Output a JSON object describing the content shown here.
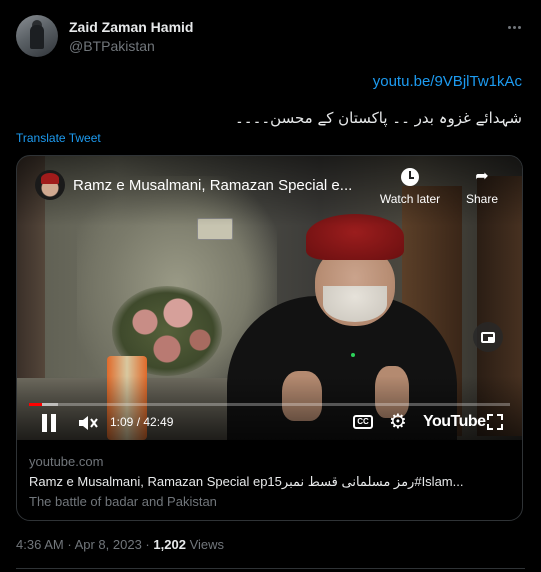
{
  "author": {
    "name": "Zaid Zaman Hamid",
    "handle": "@BTPakistan"
  },
  "tweet": {
    "link": "youtu.be/9VBjlTw1kAc",
    "text": "شہدائے غزوہ بدر ۔۔ پاکستان کے محسن۔۔۔۔",
    "translate_label": "Translate Tweet"
  },
  "video": {
    "title": "Ramz e Musalmani, Ramazan Special e...",
    "watch_later_label": "Watch later",
    "share_label": "Share",
    "time_display": "1:09 / 42:49",
    "progress_fraction": 0.027,
    "buffer_fraction": 0.06,
    "cc_label": "CC",
    "brand_label": "YouTube"
  },
  "card": {
    "domain": "youtube.com",
    "title": "Ramz e Musalmani, Ramazan Special ep15رمز مسلمانی قسط نمبر#Islam...",
    "description": "The battle of badar and Pakistan"
  },
  "footer": {
    "time": "4:36 AM",
    "separator": "·",
    "date": "Apr 8, 2023",
    "views_count": "1,202",
    "views_label": "Views"
  },
  "colors": {
    "accent": "#1d9bf0",
    "background": "#000000",
    "secondary_text": "#71767b",
    "progress": "#ff0000"
  }
}
